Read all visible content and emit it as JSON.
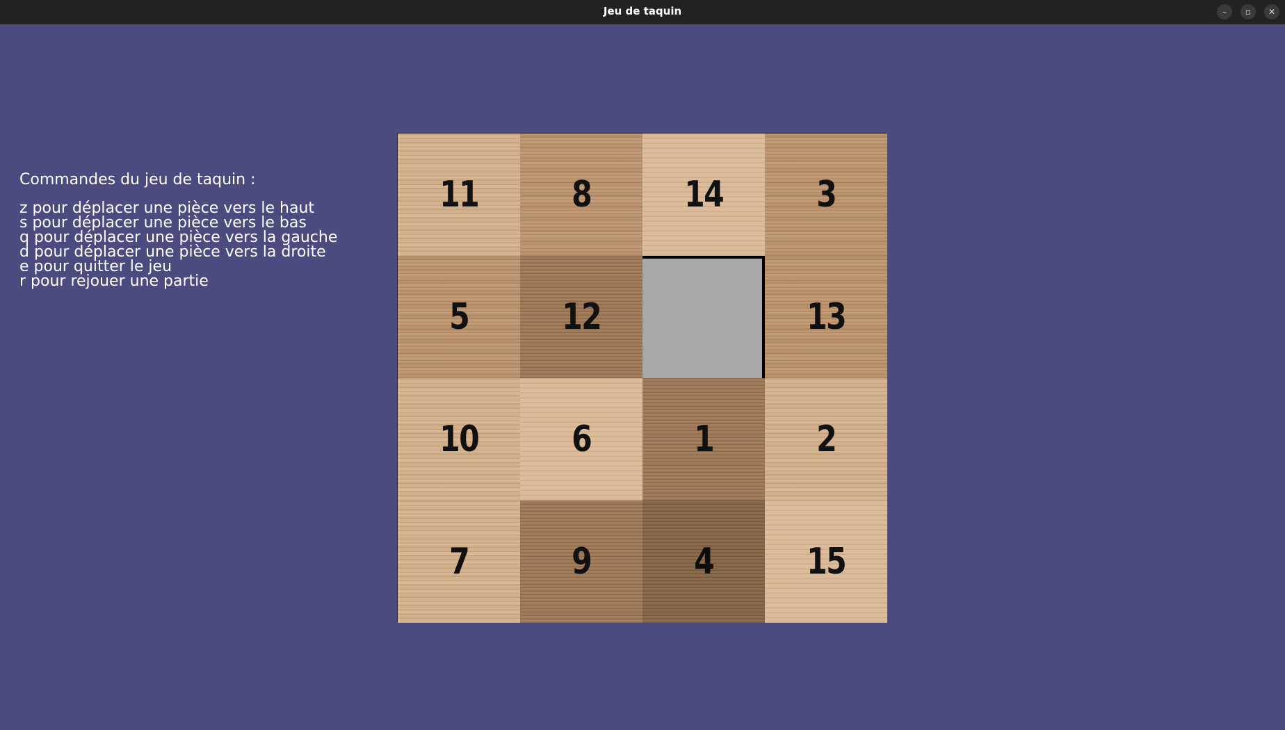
{
  "window": {
    "title": "Jeu de taquin",
    "buttons": {
      "minimize": "–",
      "maximize": "▫",
      "close": "✕"
    }
  },
  "commands": {
    "heading": "Commandes du jeu de taquin :",
    "lines": [
      "z pour déplacer une pièce vers le haut",
      "s pour déplacer une pièce vers le bas",
      "q pour déplacer une pièce vers la gauche",
      "d pour déplacer une pièce vers la droite",
      "e pour quitter le jeu",
      "r pour rejouer une partie"
    ]
  },
  "board": {
    "rows": [
      [
        "11",
        "8",
        "14",
        "3"
      ],
      [
        "5",
        "12",
        "",
        "13"
      ],
      [
        "10",
        "6",
        "1",
        "2"
      ],
      [
        "7",
        "9",
        "4",
        "15"
      ]
    ],
    "empty_cell": {
      "row": 1,
      "col": 2
    },
    "colors": {
      "background": "#4b4b7f",
      "empty": "#a8a8a8",
      "number": "#111111"
    }
  }
}
